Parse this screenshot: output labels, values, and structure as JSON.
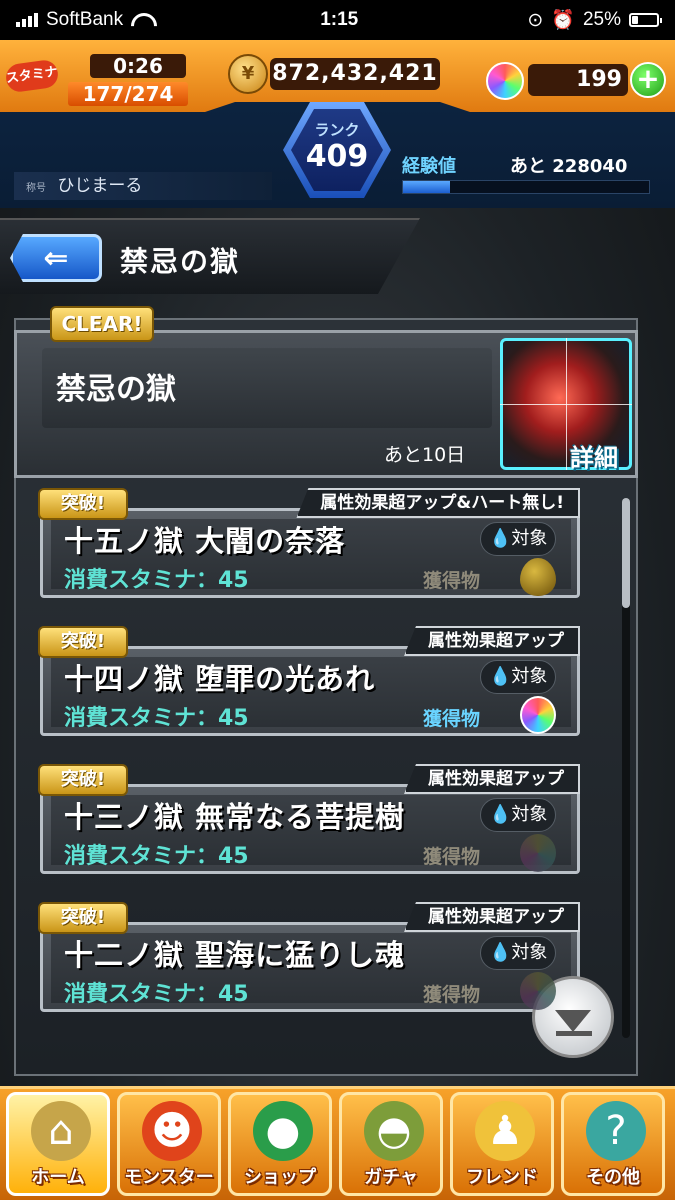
{
  "status_bar": {
    "carrier": "SoftBank",
    "time": "1:15",
    "battery": "25%"
  },
  "hud": {
    "stamina_tag": "スタミナ",
    "stamina_timer": "0:26",
    "stamina_value": "177/274",
    "gold": "872,432,421",
    "orbs": "199",
    "plus": "+",
    "rank_label": "ランク",
    "rank": "409",
    "player_title": "称号",
    "player_name": "ひじまーる",
    "exp_label": "経験値",
    "exp_remaining": "あと 228040",
    "exp_progress": 0.19
  },
  "header": {
    "back_arrow": "⇐",
    "title": "禁忌の獄"
  },
  "quest": {
    "clear_badge": "CLEAR!",
    "name": "禁忌の獄",
    "days_left": "あと10日",
    "detail_label": "詳細"
  },
  "stages": [
    {
      "tag": "突破!",
      "effect": "属性効果超アップ&ハート無し!",
      "name": "十五ノ獄 大闇の奈落",
      "target": "対象",
      "stamina": "消費スタミナ：45",
      "reward_label": "獲得物",
      "reward_icon": "egg-icon"
    },
    {
      "tag": "突破!",
      "effect": "属性効果超アップ",
      "name": "十四ノ獄 堕罪の光あれ",
      "target": "対象",
      "stamina": "消費スタミナ：45",
      "reward_label": "獲得物",
      "reward_icon": "orb-icon"
    },
    {
      "tag": "突破!",
      "effect": "属性効果超アップ",
      "name": "十三ノ獄 無常なる菩提樹",
      "target": "対象",
      "stamina": "消費スタミナ：45",
      "reward_label": "獲得物",
      "reward_icon": "orb-icon"
    },
    {
      "tag": "突破!",
      "effect": "属性効果超アップ",
      "name": "十二ノ獄 聖海に猛りし魂",
      "target": "対象",
      "stamina": "消費スタミナ：45",
      "reward_label": "獲得物",
      "reward_icon": "orb-icon"
    }
  ],
  "nav": [
    {
      "label": "ホーム",
      "icon": "home-icon",
      "glyph": "⌂"
    },
    {
      "label": "モンスター",
      "icon": "monster-icon",
      "glyph": "☻"
    },
    {
      "label": "ショップ",
      "icon": "shop-orb-icon",
      "glyph": "●"
    },
    {
      "label": "ガチャ",
      "icon": "gacha-egg-icon",
      "glyph": "◓"
    },
    {
      "label": "フレンド",
      "icon": "friend-icon",
      "glyph": "♟"
    },
    {
      "label": "その他",
      "icon": "other-icon",
      "glyph": "?"
    }
  ],
  "colors": {
    "accent_orange": "#f7a22a",
    "rank_blue": "#1a4fb8",
    "stamina_cyan": "#5fe3d5",
    "clear_gold": "#c99517"
  }
}
